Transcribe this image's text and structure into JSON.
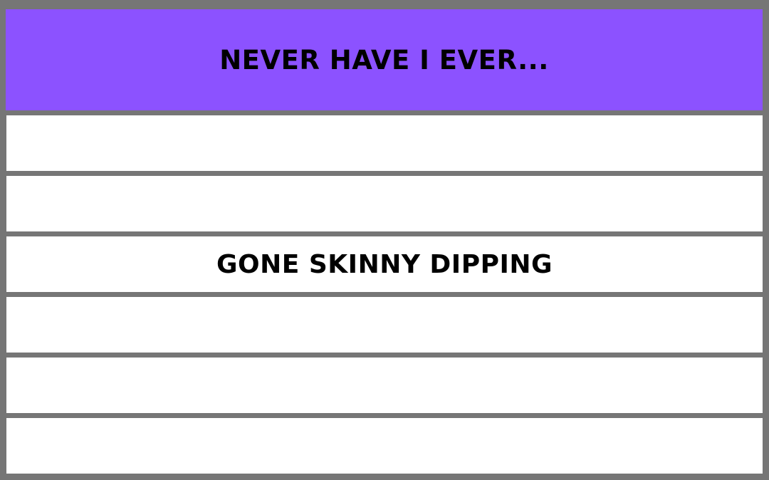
{
  "header": {
    "title": "NEVER HAVE I EVER..."
  },
  "colors": {
    "header_bg": "#8c52ff",
    "border": "#767676",
    "row_bg": "#ffffff"
  },
  "rows": [
    {
      "text": ""
    },
    {
      "text": ""
    },
    {
      "text": "GONE SKINNY DIPPING"
    },
    {
      "text": ""
    },
    {
      "text": ""
    },
    {
      "text": ""
    }
  ]
}
